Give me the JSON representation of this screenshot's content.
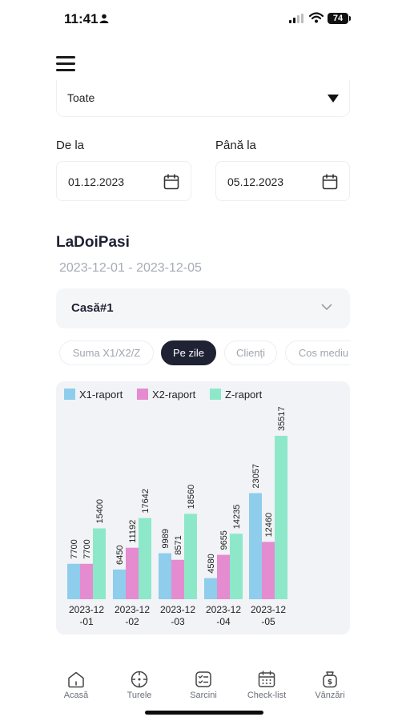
{
  "status": {
    "time": "11:41",
    "battery": "74"
  },
  "filter": {
    "selected": "Toate"
  },
  "dates": {
    "from_label": "De la",
    "from_value": "01.12.2023",
    "to_label": "Până la",
    "to_value": "05.12.2023"
  },
  "report": {
    "title": "LaDoiPasi",
    "range": "2023-12-01 - 2023-12-05",
    "register": "Casă#1"
  },
  "tabs": [
    {
      "label": "Suma X1/X2/Z",
      "active": false
    },
    {
      "label": "Pe zile",
      "active": true
    },
    {
      "label": "Clienți",
      "active": false
    },
    {
      "label": "Cos mediu",
      "active": false
    }
  ],
  "colors": {
    "x1": "#8ecdec",
    "x2": "#e58bd0",
    "z": "#8de8c9",
    "dark": "#1f2233"
  },
  "chart_data": {
    "type": "bar",
    "categories": [
      "2023-12\n-01",
      "2023-12\n-02",
      "2023-12\n-03",
      "2023-12\n-04",
      "2023-12\n-05"
    ],
    "series": [
      {
        "name": "X1-raport",
        "values": [
          7700,
          6450,
          9989,
          4580,
          23057
        ]
      },
      {
        "name": "X2-raport",
        "values": [
          7700,
          11192,
          8571,
          9655,
          12460
        ]
      },
      {
        "name": "Z-raport",
        "values": [
          15400,
          17642,
          18560,
          14235,
          35517
        ]
      }
    ],
    "ylim": [
      0,
      35517
    ],
    "legend": "top-left",
    "grid": false
  },
  "nav": [
    {
      "label": "Acasă",
      "icon": "home-icon"
    },
    {
      "label": "Turele",
      "icon": "crosshair-icon"
    },
    {
      "label": "Sarcini",
      "icon": "tasks-icon"
    },
    {
      "label": "Check-list",
      "icon": "calendar-icon"
    },
    {
      "label": "Vânzări",
      "icon": "money-bag-icon"
    }
  ]
}
